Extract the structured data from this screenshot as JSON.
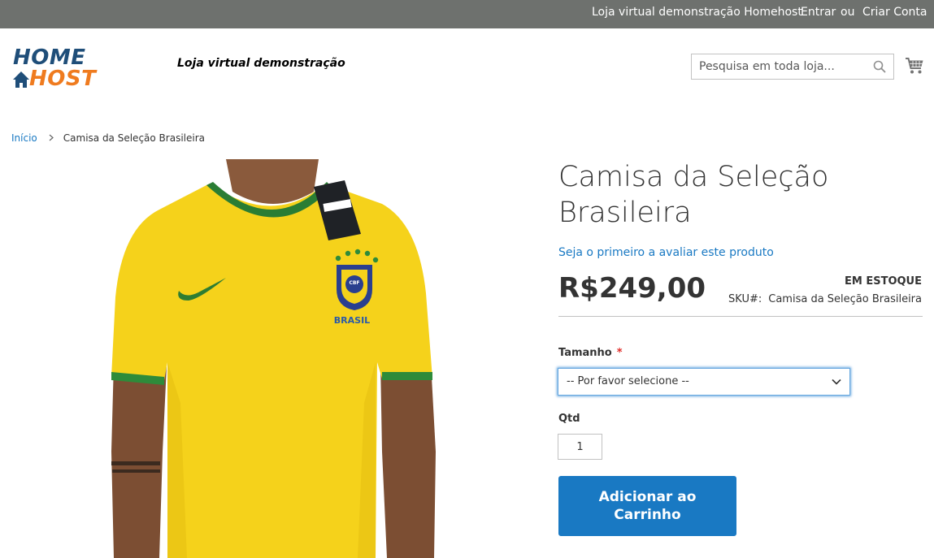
{
  "header": {
    "welcome": "Loja virtual demonstração Homehost",
    "sign_in": "Entrar",
    "or": "ou",
    "create_account": "Criar Conta",
    "logo_line1": "HOME",
    "logo_line2": "HOST",
    "tagline": "Loja virtual demonstração",
    "search_placeholder": "Pesquisa em toda loja...",
    "colors": {
      "topbar": "#6e716e",
      "logo_blue": "#1f4e79",
      "logo_orange": "#ef7b1f",
      "accent": "#1979c3"
    }
  },
  "breadcrumb": {
    "home": "Início",
    "current": "Camisa da Seleção Brasileira"
  },
  "product": {
    "title": "Camisa da Seleção Brasileira",
    "review_link": "Seja o primeiro a avaliar este produto",
    "price": "R$249,00",
    "stock": "EM ESTOQUE",
    "sku_label": "SKU#:",
    "sku_value": "Camisa da Seleção Brasileira",
    "image_text": {
      "crest": "CBF",
      "country": "BRASIL"
    }
  },
  "options": {
    "size_label": "Tamanho",
    "required_mark": "*",
    "size_selected": "-- Por favor selecione --",
    "qty_label": "Qtd",
    "qty_value": "1",
    "add_to_cart": "Adicionar ao Carrinho"
  }
}
